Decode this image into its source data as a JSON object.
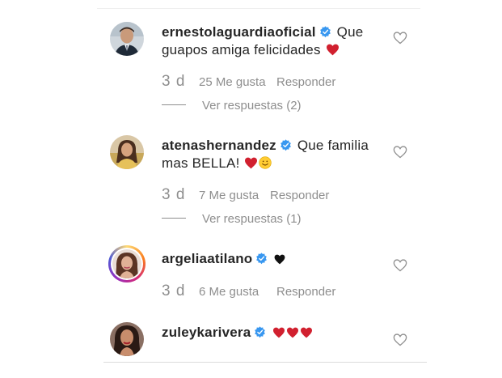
{
  "comments": [
    {
      "username": "ernestolaguardiaoficial",
      "verified": true,
      "text": "Que guapos amiga felicidades",
      "emoji": [
        "red-heart"
      ],
      "time": "3 d",
      "likes": "25 Me gusta",
      "reply_label": "Responder",
      "view_replies": "Ver respuestas (2)"
    },
    {
      "username": "atenashernandez",
      "verified": true,
      "text": "Que familia mas BELLA!",
      "emoji": [
        "red-heart",
        "smiling-face"
      ],
      "time": "3 d",
      "likes": "7 Me gusta",
      "reply_label": "Responder",
      "view_replies": "Ver respuestas (1)"
    },
    {
      "username": "argeliaatilano",
      "verified": true,
      "text": "",
      "emoji": [
        "black-heart"
      ],
      "time": "3 d",
      "likes": "6 Me gusta",
      "reply_label": "Responder",
      "has_story_ring": true
    },
    {
      "username": "zuleykarivera",
      "verified": true,
      "text": "",
      "emoji": [
        "red-heart",
        "red-heart",
        "red-heart"
      ]
    }
  ],
  "colors": {
    "verified_blue": "#3897f0",
    "heart_red": "#d1202f",
    "meta_gray": "#8e8e8e",
    "text": "#262626"
  }
}
